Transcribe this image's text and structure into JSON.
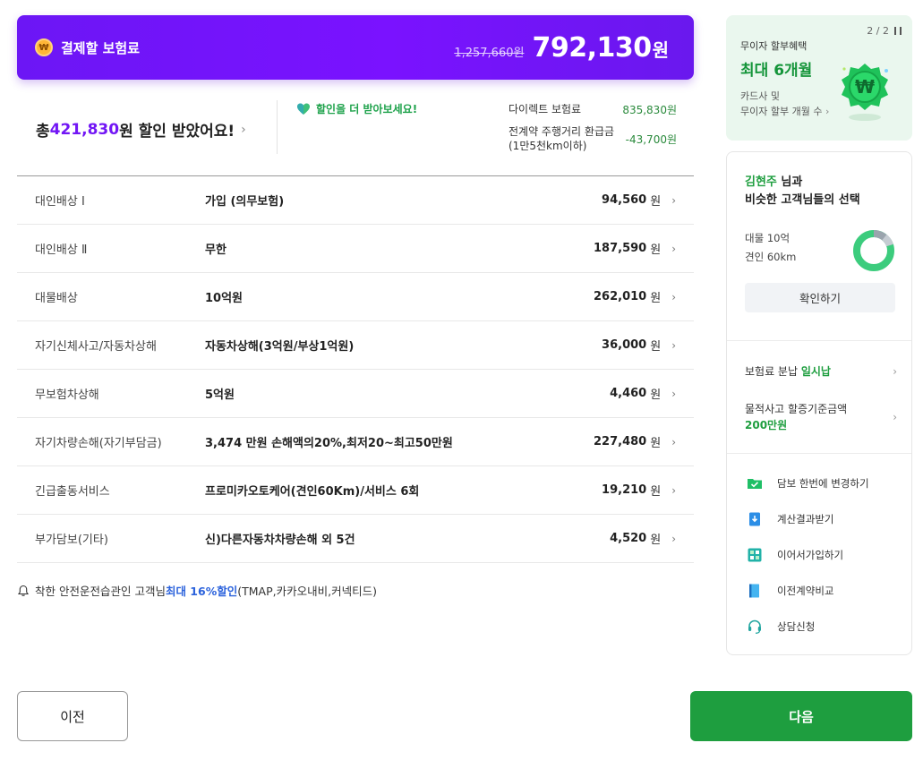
{
  "premium": {
    "label": "결제할 보험료",
    "original_price": "1,257,660원",
    "final_price": "792,130",
    "unit": "원"
  },
  "discount": {
    "prefix": "총 ",
    "amount": "421,830",
    "suffix": "원 할인 받았어요!",
    "more_text": "할인을 더 받아보세요!"
  },
  "direct": {
    "rows": [
      {
        "label": "다이렉트 보험료",
        "value": "835,830원"
      },
      {
        "label_line1": "전계약 주행거리 환급금",
        "label_line2": "(1만5천km이하)",
        "value": "-43,700원"
      }
    ]
  },
  "coverages": [
    {
      "name": "대인배상 Ⅰ",
      "value": "가입 (의무보험)",
      "price": "94,560",
      "unit": "원"
    },
    {
      "name": "대인배상 Ⅱ",
      "value": "무한",
      "price": "187,590",
      "unit": "원"
    },
    {
      "name": "대물배상",
      "value": "10억원",
      "price": "262,010",
      "unit": "원"
    },
    {
      "name": "자기신체사고/자동차상해",
      "value": "자동차상해(3억원/부상1억원)",
      "price": "36,000",
      "unit": "원"
    },
    {
      "name": "무보험차상해",
      "value": "5억원",
      "price": "4,460",
      "unit": "원"
    },
    {
      "name": "자기차량손해(자기부담금)",
      "value": "3,474 만원 손해액의20%,최저20~최고50만원",
      "price": "227,480",
      "unit": "원"
    },
    {
      "name": "긴급출동서비스",
      "value": "프로미카오토케어(견인60Km)/서비스 6회",
      "price": "19,210",
      "unit": "원"
    },
    {
      "name": "부가담보(기타)",
      "value": "신)다른자동차차량손해 외 5건",
      "price": "4,520",
      "unit": "원"
    }
  ],
  "notice": {
    "prefix": "착한 안전운전습관인 고객님 ",
    "highlight": "최대 16%할인",
    "suffix": "(TMAP,카카오내비,커넥티드)"
  },
  "buttons": {
    "prev": "이전",
    "next": "다음"
  },
  "promo": {
    "pager": "2 / 2",
    "subtitle": "무이자 할부혜택",
    "title": "최대 6개월",
    "desc_line1": "카드사 및",
    "desc_line2": "무이자 할부 개월 수",
    "badge_symbol": "₩"
  },
  "choice": {
    "customer_name": "김현주",
    "title_suffix": " 님과",
    "title_line2": "비슷한 고객님들의 선택",
    "items": [
      "대물 10억",
      "견인 60km"
    ],
    "confirm_label": "확인하기"
  },
  "options": [
    {
      "label": "보험료 분납 ",
      "value": "일시납"
    },
    {
      "label": "물적사고 할증기준금액",
      "value": "200만원"
    }
  ],
  "menu": [
    {
      "label": "담보 한번에 변경하기",
      "icon": "folder-check-icon"
    },
    {
      "label": "계산결과받기",
      "icon": "download-doc-icon"
    },
    {
      "label": "이어서가입하기",
      "icon": "continue-grid-icon"
    },
    {
      "label": "이전계약비교",
      "icon": "compare-book-icon"
    },
    {
      "label": "상담신청",
      "icon": "headset-icon"
    }
  ],
  "colors": {
    "brand_purple": "#7216f5",
    "brand_green": "#1e9e3f",
    "highlight_blue": "#2c63dc"
  }
}
